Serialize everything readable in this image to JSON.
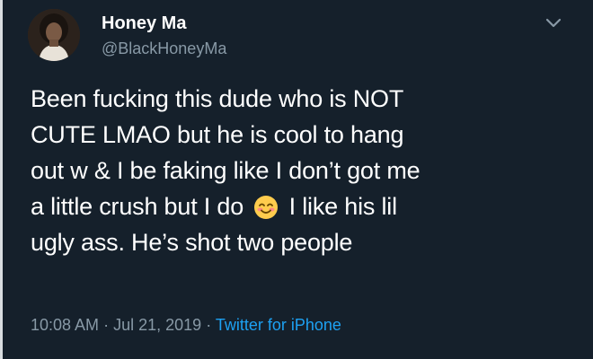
{
  "tweet": {
    "display_name": "Honey Ma",
    "handle": "@BlackHoneyMa",
    "lines": [
      {
        "text": "Been fucking this dude who is NOT"
      },
      {
        "text": "CUTE LMAO but he is cool to hang"
      },
      {
        "text": "out w & I be faking like I don’t got me"
      },
      {
        "before": "a little crush but I do",
        "emoji": "smiling-face-with-smiling-eyes",
        "after": "I like his lil"
      },
      {
        "text": "ugly ass. He’s shot two people"
      }
    ],
    "time": "10:08 AM",
    "separator1": "·",
    "date": "Jul 21, 2019",
    "separator2": "·",
    "source": "Twitter for iPhone"
  },
  "icons": {
    "avatar": "profile-photo",
    "caret": "chevron-down-icon"
  },
  "colors": {
    "background": "#15202b",
    "secondary_text": "#8899a6",
    "link": "#1da1f2"
  }
}
